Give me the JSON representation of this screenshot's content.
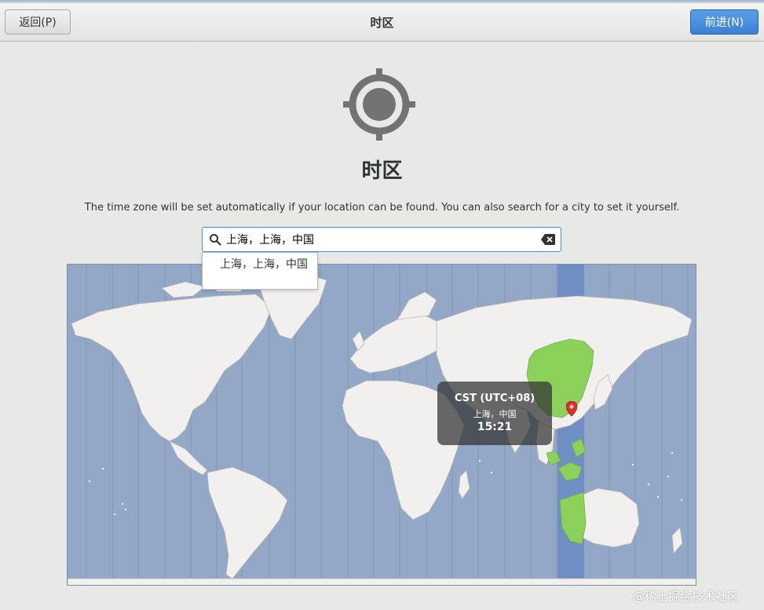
{
  "header": {
    "back_label": "返回(P)",
    "title": "时区",
    "next_label": "前进(N)"
  },
  "page": {
    "heading": "时区",
    "description": "The time zone will be set automatically if your location can be found. You can also search for a city to set it yourself."
  },
  "search": {
    "value": "上海，上海，中国",
    "suggestions": [
      "上海，上海，中国"
    ]
  },
  "tooltip": {
    "abbreviation": "CST (UTC+08)",
    "city": "上海，中国",
    "time": "15:21"
  },
  "watermark": "@稀土掘金技术社区",
  "colors": {
    "ocean": "#93a8c6",
    "land": "#f2f0ef",
    "selected_zone_land": "#8bd15a",
    "selected_zone_band": "#6f8fc4",
    "accent": "#4a90d9",
    "pin": "#e0302a"
  },
  "icons": {
    "locate": "crosshair-target-icon",
    "search": "magnifier-icon",
    "clear": "backspace-clear-icon",
    "pin": "map-pin-icon"
  }
}
